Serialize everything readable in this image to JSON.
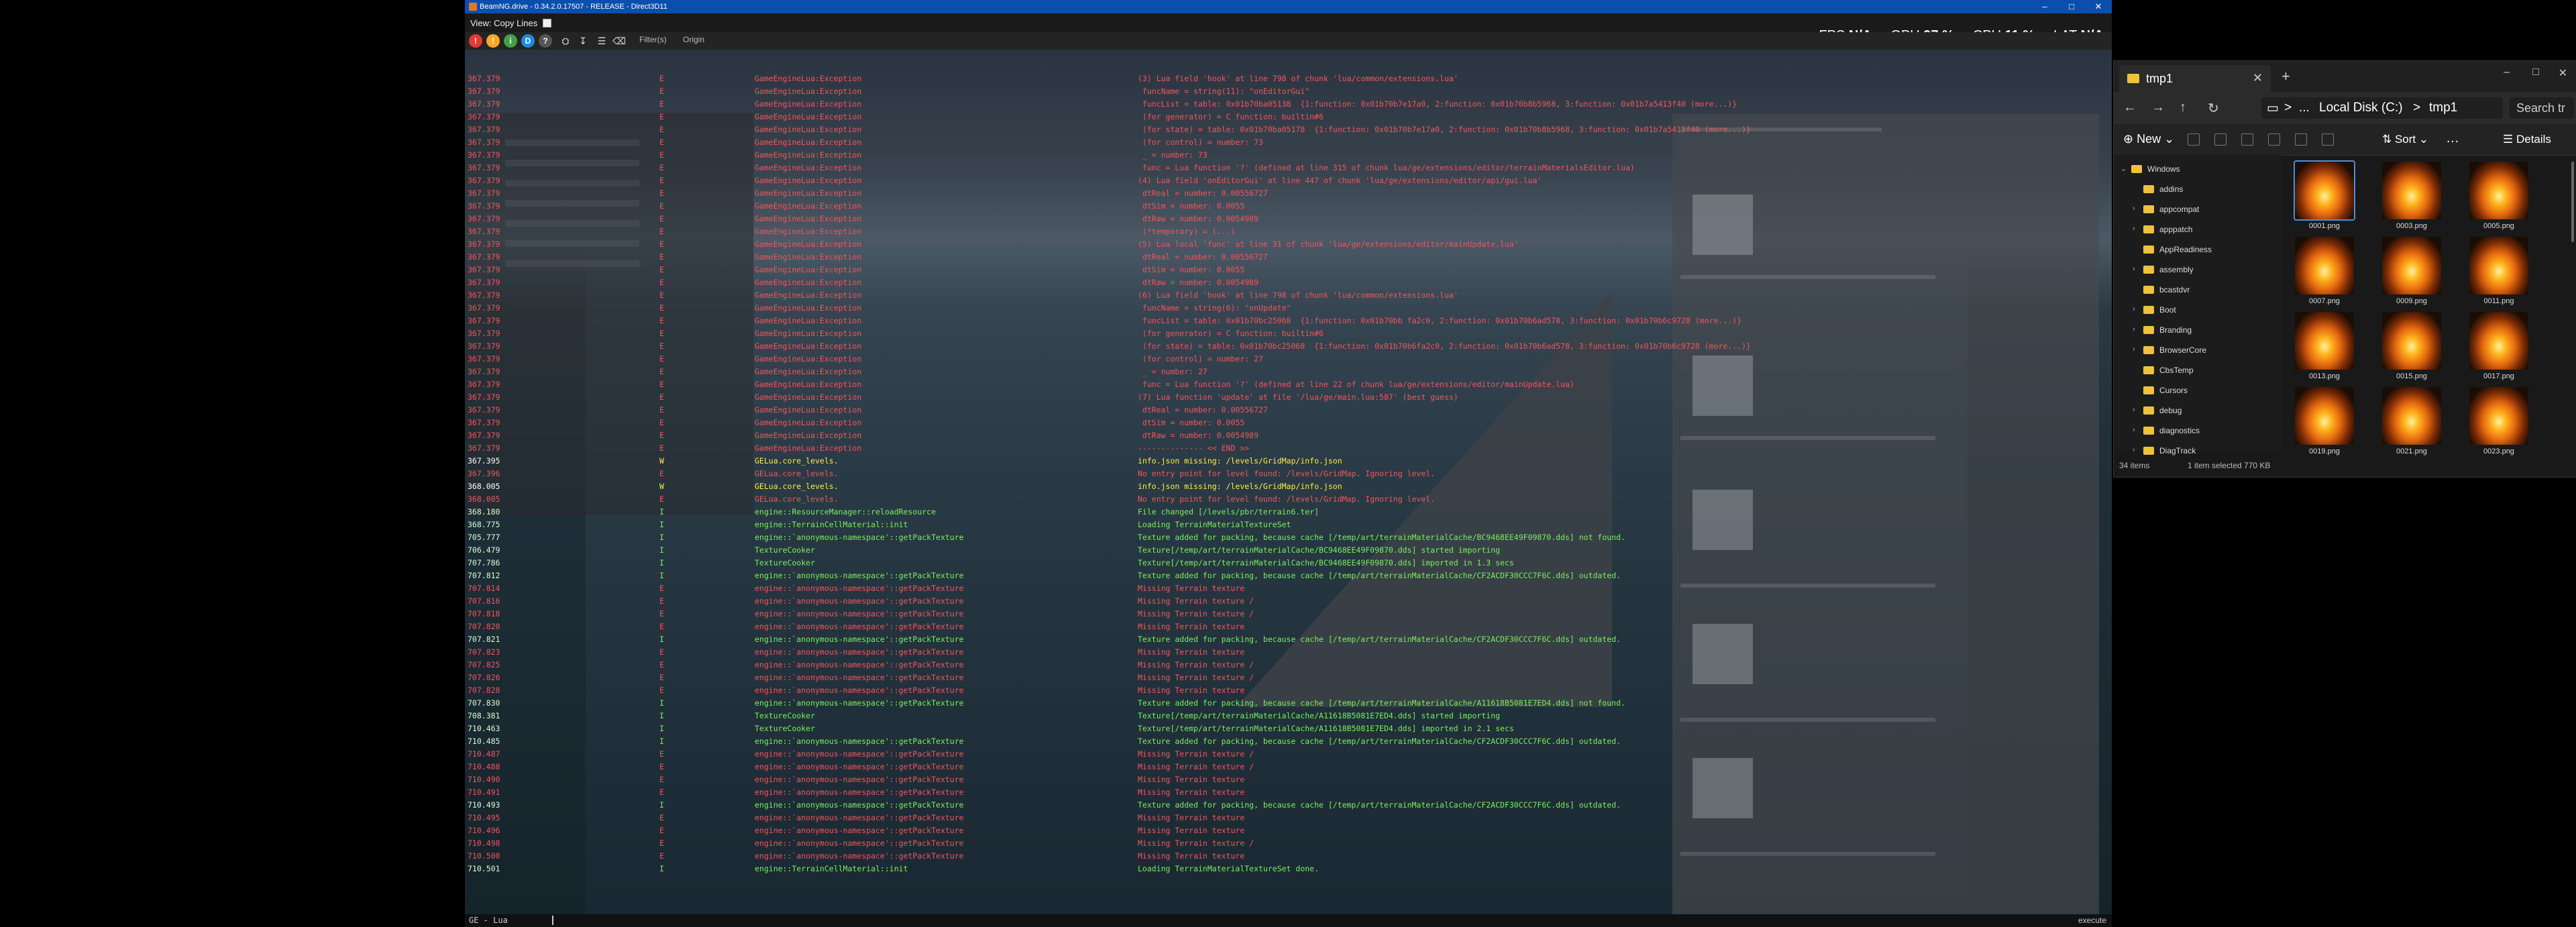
{
  "game": {
    "title": "BeamNG.drive - 0.34.2.0.17507 - RELEASE - Direct3D11",
    "menu": {
      "view_label": "View: Copy Lines"
    },
    "perf": {
      "fps_label": "FPS",
      "fps_value": "N/A",
      "gpu_label": "GPU",
      "gpu_value": "97 %",
      "cpu_label": "CPU",
      "cpu_value": "11 %",
      "lat_label": "LAT",
      "lat_value": "N/A"
    },
    "toolbar": {
      "filter_label": "Filter(s)",
      "origin_label": "Origin"
    },
    "status": {
      "prompt": "GE - Lua",
      "exec_label": "execute"
    },
    "accent_colors": {
      "error": "#f3555c",
      "info": "#78f05b",
      "warn": "#ffe94a",
      "titlebar": "#0b4fae"
    }
  },
  "console": {
    "rows": [
      {
        "t": "367.379",
        "l": "E",
        "s": "GameEngineLua:Exception",
        "m": "(3) Lua field 'hook' at line 798 of chunk 'lua/common/extensions.lua'"
      },
      {
        "t": "367.379",
        "l": "E",
        "s": "GameEngineLua:Exception",
        "m": " funcName = string(11): \"onEditorGui\""
      },
      {
        "t": "367.379",
        "l": "E",
        "s": "GameEngineLua:Exception",
        "m": " funcList = table: 0x01b70ba05138  {1:function: 0x01b70b7e17a0, 2:function: 0x01b70b8b5968, 3:function: 0x01b7a5413f40 (more...)}"
      },
      {
        "t": "367.379",
        "l": "E",
        "s": "GameEngineLua:Exception",
        "m": " (for generator) = C function: builtin#6"
      },
      {
        "t": "367.379",
        "l": "E",
        "s": "GameEngineLua:Exception",
        "m": " (for state) = table: 0x01b70ba05178  {1:function: 0x01b70b7e17a0, 2:function: 0x01b70b8b5968, 3:function: 0x01b7a5413f40 (more...)}"
      },
      {
        "t": "367.379",
        "l": "E",
        "s": "GameEngineLua:Exception",
        "m": " (for control) = number: 73"
      },
      {
        "t": "367.379",
        "l": "E",
        "s": "GameEngineLua:Exception",
        "m": " _ = number: 73"
      },
      {
        "t": "367.379",
        "l": "E",
        "s": "GameEngineLua:Exception",
        "m": " func = Lua function '?' (defined at line 315 of chunk lua/ge/extensions/editor/terrainMaterialsEditor.lua)"
      },
      {
        "t": "367.379",
        "l": "E",
        "s": "GameEngineLua:Exception",
        "m": "(4) Lua field 'onEditorGui' at line 447 of chunk 'lua/ge/extensions/editor/api/gui.lua'"
      },
      {
        "t": "367.379",
        "l": "E",
        "s": "GameEngineLua:Exception",
        "m": " dtReal = number: 0.00556727"
      },
      {
        "t": "367.379",
        "l": "E",
        "s": "GameEngineLua:Exception",
        "m": " dtSim = number: 0.0055"
      },
      {
        "t": "367.379",
        "l": "E",
        "s": "GameEngineLua:Exception",
        "m": " dtRaw = number: 0.0054989"
      },
      {
        "t": "367.379",
        "l": "E",
        "s": "GameEngineLua:Exception",
        "m": " (*temporary) = (...)"
      },
      {
        "t": "367.379",
        "l": "E",
        "s": "GameEngineLua:Exception",
        "m": "(5) Lua local 'func' at line 31 of chunk 'lua/ge/extensions/editor/mainUpdate.lua'"
      },
      {
        "t": "367.379",
        "l": "E",
        "s": "GameEngineLua:Exception",
        "m": " dtReal = number: 0.00556727"
      },
      {
        "t": "367.379",
        "l": "E",
        "s": "GameEngineLua:Exception",
        "m": " dtSim = number: 0.0055"
      },
      {
        "t": "367.379",
        "l": "E",
        "s": "GameEngineLua:Exception",
        "m": " dtRaw = number: 0.0054989"
      },
      {
        "t": "367.379",
        "l": "E",
        "s": "GameEngineLua:Exception",
        "m": "(6) Lua field 'hook' at line 798 of chunk 'lua/common/extensions.lua'"
      },
      {
        "t": "367.379",
        "l": "E",
        "s": "GameEngineLua:Exception",
        "m": " funcName = string(6): \"onUpdate\""
      },
      {
        "t": "367.379",
        "l": "E",
        "s": "GameEngineLua:Exception",
        "m": " funcList = table: 0x01b70bc25068  {1:function: 0x01b70bb fa2c0, 2:function: 0x01b70b6ad578, 3:function: 0x01b70b6c9728 (more...)}"
      },
      {
        "t": "367.379",
        "l": "E",
        "s": "GameEngineLua:Exception",
        "m": " (for generator) = C function: builtin#6"
      },
      {
        "t": "367.379",
        "l": "E",
        "s": "GameEngineLua:Exception",
        "m": " (for state) = table: 0x01b70bc25068  {1:function: 0x01b70b6fa2c0, 2:function: 0x01b70b6ad578, 3:function: 0x01b70b6c9728 (more...)}"
      },
      {
        "t": "367.379",
        "l": "E",
        "s": "GameEngineLua:Exception",
        "m": " (for control) = number: 27"
      },
      {
        "t": "367.379",
        "l": "E",
        "s": "GameEngineLua:Exception",
        "m": " _ = number: 27"
      },
      {
        "t": "367.379",
        "l": "E",
        "s": "GameEngineLua:Exception",
        "m": " func = Lua function '?' (defined at line 22 of chunk lua/ge/extensions/editor/mainUpdate.lua)"
      },
      {
        "t": "367.379",
        "l": "E",
        "s": "GameEngineLua:Exception",
        "m": "(7) Lua function 'update' at file '/lua/ge/main.lua:587' (best guess)"
      },
      {
        "t": "367.379",
        "l": "E",
        "s": "GameEngineLua:Exception",
        "m": " dtReal = number: 0.00556727"
      },
      {
        "t": "367.379",
        "l": "E",
        "s": "GameEngineLua:Exception",
        "m": " dtSim = number: 0.0055"
      },
      {
        "t": "367.379",
        "l": "E",
        "s": "GameEngineLua:Exception",
        "m": " dtRaw = number: 0.0054989"
      },
      {
        "t": "367.379",
        "l": "E",
        "s": "GameEngineLua:Exception",
        "m": "-------------- << END >>"
      },
      {
        "t": "367.395",
        "l": "W",
        "s": "GELua.core_levels.",
        "m": "info.json missing: /levels/GridMap/info.json"
      },
      {
        "t": "367.396",
        "l": "E",
        "s": "GELua.core_levels.",
        "m": "No entry point for level found: /levels/GridMap. Ignoring level."
      },
      {
        "t": "368.005",
        "l": "W",
        "s": "GELua.core_levels.",
        "m": "info.json missing: /levels/GridMap/info.json"
      },
      {
        "t": "368.005",
        "l": "E",
        "s": "GELua.core_levels.",
        "m": "No entry point for level found: /levels/GridMap. Ignoring level."
      },
      {
        "t": "368.180",
        "l": "I",
        "s": "engine::ResourceManager::reloadResource",
        "m": "File changed [/levels/pbr/terrain6.ter]"
      },
      {
        "t": "368.775",
        "l": "I",
        "s": "engine::TerrainCellMaterial::init",
        "m": "Loading TerrainMaterialTextureSet"
      },
      {
        "t": "705.777",
        "l": "I",
        "s": "engine::`anonymous-namespace'::getPackTexture",
        "m": "Texture added for packing, because cache [/temp/art/terrainMaterialCache/BC9468EE49F09870.dds] not found."
      },
      {
        "t": "706.479",
        "l": "I",
        "s": "TextureCooker",
        "m": "Texture[/temp/art/terrainMaterialCache/BC9468EE49F09870.dds] started importing"
      },
      {
        "t": "707.786",
        "l": "I",
        "s": "TextureCooker",
        "m": "Texture[/temp/art/terrainMaterialCache/BC9468EE49F09870.dds] imported in 1.3 secs"
      },
      {
        "t": "707.812",
        "l": "I",
        "s": "engine::`anonymous-namespace'::getPackTexture",
        "m": "Texture added for packing, because cache [/temp/art/terrainMaterialCache/CF2ACDF30CCC7F6C.dds] outdated."
      },
      {
        "t": "707.814",
        "l": "E",
        "s": "engine::`anonymous-namespace'::getPackTexture",
        "m": "Missing Terrain texture"
      },
      {
        "t": "707.816",
        "l": "E",
        "s": "engine::`anonymous-namespace'::getPackTexture",
        "m": "Missing Terrain texture /"
      },
      {
        "t": "707.818",
        "l": "E",
        "s": "engine::`anonymous-namespace'::getPackTexture",
        "m": "Missing Terrain texture /"
      },
      {
        "t": "707.820",
        "l": "E",
        "s": "engine::`anonymous-namespace'::getPackTexture",
        "m": "Missing Terrain texture"
      },
      {
        "t": "707.821",
        "l": "I",
        "s": "engine::`anonymous-namespace'::getPackTexture",
        "m": "Texture added for packing, because cache [/temp/art/terrainMaterialCache/CF2ACDF30CCC7F6C.dds] outdated."
      },
      {
        "t": "707.823",
        "l": "E",
        "s": "engine::`anonymous-namespace'::getPackTexture",
        "m": "Missing Terrain texture"
      },
      {
        "t": "707.825",
        "l": "E",
        "s": "engine::`anonymous-namespace'::getPackTexture",
        "m": "Missing Terrain texture /"
      },
      {
        "t": "707.826",
        "l": "E",
        "s": "engine::`anonymous-namespace'::getPackTexture",
        "m": "Missing Terrain texture /"
      },
      {
        "t": "707.828",
        "l": "E",
        "s": "engine::`anonymous-namespace'::getPackTexture",
        "m": "Missing Terrain texture"
      },
      {
        "t": "707.830",
        "l": "I",
        "s": "engine::`anonymous-namespace'::getPackTexture",
        "m": "Texture added for packing, because cache [/temp/art/terrainMaterialCache/A11618B5081E7ED4.dds] not found."
      },
      {
        "t": "708.381",
        "l": "I",
        "s": "TextureCooker",
        "m": "Texture[/temp/art/terrainMaterialCache/A11618B5081E7ED4.dds] started importing"
      },
      {
        "t": "710.463",
        "l": "I",
        "s": "TextureCooker",
        "m": "Texture[/temp/art/terrainMaterialCache/A11618B5081E7ED4.dds] imported in 2.1 secs"
      },
      {
        "t": "710.485",
        "l": "I",
        "s": "engine::`anonymous-namespace'::getPackTexture",
        "m": "Texture added for packing, because cache [/temp/art/terrainMaterialCache/CF2ACDF30CCC7F6C.dds] outdated."
      },
      {
        "t": "710.487",
        "l": "E",
        "s": "engine::`anonymous-namespace'::getPackTexture",
        "m": "Missing Terrain texture /"
      },
      {
        "t": "710.488",
        "l": "E",
        "s": "engine::`anonymous-namespace'::getPackTexture",
        "m": "Missing Terrain texture /"
      },
      {
        "t": "710.490",
        "l": "E",
        "s": "engine::`anonymous-namespace'::getPackTexture",
        "m": "Missing Terrain texture"
      },
      {
        "t": "710.491",
        "l": "E",
        "s": "engine::`anonymous-namespace'::getPackTexture",
        "m": "Missing Terrain texture"
      },
      {
        "t": "710.493",
        "l": "I",
        "s": "engine::`anonymous-namespace'::getPackTexture",
        "m": "Texture added for packing, because cache [/temp/art/terrainMaterialCache/CF2ACDF30CCC7F6C.dds] outdated."
      },
      {
        "t": "710.495",
        "l": "E",
        "s": "engine::`anonymous-namespace'::getPackTexture",
        "m": "Missing Terrain texture"
      },
      {
        "t": "710.496",
        "l": "E",
        "s": "engine::`anonymous-namespace'::getPackTexture",
        "m": "Missing Terrain texture"
      },
      {
        "t": "710.498",
        "l": "E",
        "s": "engine::`anonymous-namespace'::getPackTexture",
        "m": "Missing Terrain texture /"
      },
      {
        "t": "710.500",
        "l": "E",
        "s": "engine::`anonymous-namespace'::getPackTexture",
        "m": "Missing Terrain texture"
      },
      {
        "t": "710.501",
        "l": "I",
        "s": "engine::TerrainCellMaterial::init",
        "m": "Loading TerrainMaterialTextureSet done."
      }
    ]
  },
  "explorer": {
    "tab_title": "tmp1",
    "address": {
      "drive": "Local Disk (C:)",
      "folder": "tmp1",
      "sep": ">",
      "ellipsis": "..."
    },
    "search_placeholder": "Search tr",
    "commands": {
      "new_label": "New",
      "sort_label": "Sort",
      "more_label": "…",
      "details_label": "Details"
    },
    "tree": [
      {
        "label": "Windows",
        "expanded": true,
        "indent": 0
      },
      {
        "label": "addins",
        "indent": 1
      },
      {
        "label": "appcompat",
        "indent": 1,
        "chev": true
      },
      {
        "label": "apppatch",
        "indent": 1,
        "chev": true
      },
      {
        "label": "AppReadiness",
        "indent": 1
      },
      {
        "label": "assembly",
        "indent": 1,
        "chev": true
      },
      {
        "label": "bcastdvr",
        "indent": 1
      },
      {
        "label": "Boot",
        "indent": 1,
        "chev": true
      },
      {
        "label": "Branding",
        "indent": 1,
        "chev": true
      },
      {
        "label": "BrowserCore",
        "indent": 1,
        "chev": true
      },
      {
        "label": "CbsTemp",
        "indent": 1
      },
      {
        "label": "Cursors",
        "indent": 1
      },
      {
        "label": "debug",
        "indent": 1,
        "chev": true
      },
      {
        "label": "diagnostics",
        "indent": 1,
        "chev": true
      },
      {
        "label": "DiagTrack",
        "indent": 1,
        "chev": true
      }
    ],
    "files": [
      "0001.png",
      "0003.png",
      "0005.png",
      "0007.png",
      "0009.png",
      "0011.png",
      "0013.png",
      "0015.png",
      "0017.png",
      "0019.png",
      "0021.png",
      "0023.png"
    ],
    "selected_file": "0001.png",
    "status": {
      "items": "34 items",
      "selection": "1 item selected  770 KB"
    }
  }
}
